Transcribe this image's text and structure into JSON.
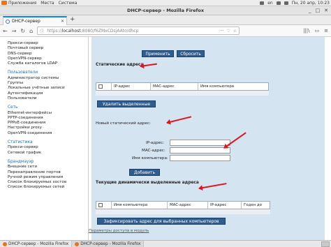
{
  "top_panel": {
    "menus": [
      "Приложения",
      "Места",
      "Система"
    ],
    "language": "en",
    "datetime": "Пн, 20 апр, 10:23"
  },
  "window": {
    "title": "DHCP-сервер - Mozilla Firefox",
    "controls": [
      "_",
      "□",
      "✕"
    ]
  },
  "tab": {
    "label": "DHCP-сервер",
    "close": "✕",
    "new_tab": "+"
  },
  "nav": {
    "url_prefix": "https://",
    "url_host": "localhost",
    "url_rest": ":8080/f6ZMxCDsjAAto/dhcp",
    "url_actions": [
      "···",
      "♡",
      "☆"
    ],
    "right_icons": [
      "|||\\",
      "▭",
      "≡"
    ]
  },
  "sidebar": {
    "sections": [
      {
        "title": "",
        "items": [
          "Прокси-сервер",
          "Почтовый сервер",
          "DNS-сервер",
          "OpenVPN-сервер",
          "Служба каталогов LDAP"
        ]
      },
      {
        "title": "Пользователи",
        "items": [
          "Администратор системы",
          "Группы",
          "Локальные учётные записи",
          "Аутентификация",
          "Пользователи"
        ]
      },
      {
        "title": "Сеть",
        "items": [
          "Ethernet-интерфейсы",
          "PPTP-соединения",
          "PPPoE-соединения",
          "Настройки proxy",
          "OpenVPN-соединения"
        ]
      },
      {
        "title": "Статистика",
        "items": [
          "Прокси-сервер",
          "Сетевой трафик"
        ]
      },
      {
        "title": "Брандмауэр",
        "items": [
          "Внешние сети",
          "Перенаправление портов",
          "Ручной режим управления",
          "Список блокируемых хостов",
          "Список блокируемых сетей"
        ]
      }
    ]
  },
  "main": {
    "apply_button": "Применить",
    "reset_button": "Сбросить",
    "static_title": "Статические адреса",
    "static_columns": [
      "",
      "IP-адрес",
      "MAC-адрес",
      "Имя компьютера"
    ],
    "delete_button": "Удалить выделенные",
    "new_static_label": "Новый статический адрес:",
    "ip_label": "IP-адрес:",
    "mac_label": "MAC-адрес:",
    "host_label": "Имя компьютера:",
    "ip_value": "",
    "mac_value": "",
    "host_value": "",
    "add_button": "Добавить",
    "dynamic_title": "Текущие динамически выделенные адреса",
    "dynamic_columns": [
      "",
      "Имя компьютера",
      "MAC-адрес",
      "IP-адрес",
      "Годен до"
    ],
    "fix_button": "Зафиксировать адрес для выбранных компьютеров",
    "footer_link": "Параметры доступа в модуль"
  },
  "taskbar": {
    "tasks": [
      "DHCP-сервер - Mozilla Firefox",
      "DHCP-сервер - Mozilla Firefox"
    ]
  },
  "colors": {
    "accent": "#2f5d8f",
    "panel_bg": "#d5e4f1",
    "sidebar_group": "#1b6fb8",
    "annotation_arrow": "#e0141e"
  }
}
